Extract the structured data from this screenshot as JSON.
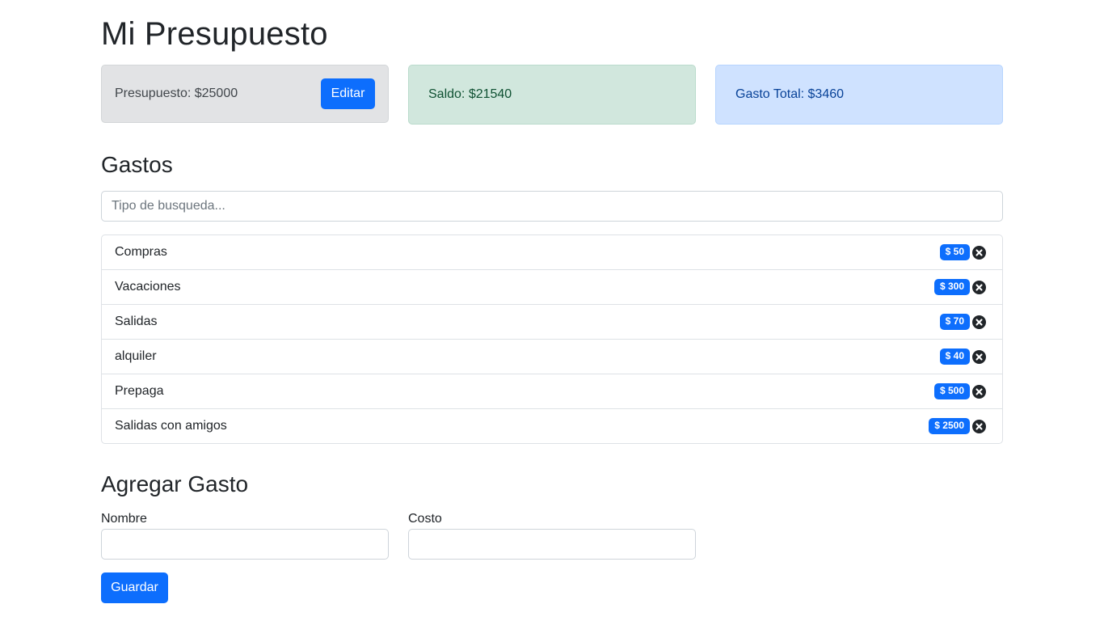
{
  "header": {
    "title": "Mi Presupuesto"
  },
  "summary": {
    "budget_text": "Presupuesto: $25000",
    "edit_label": "Editar",
    "balance_text": "Saldo: $21540",
    "total_text": "Gasto Total: $3460"
  },
  "expenses": {
    "title": "Gastos",
    "search_placeholder": "Tipo de busqueda...",
    "items": [
      {
        "name": "Compras",
        "cost": "$ 50"
      },
      {
        "name": "Vacaciones",
        "cost": "$ 300"
      },
      {
        "name": "Salidas",
        "cost": "$ 70"
      },
      {
        "name": "alquiler",
        "cost": "$ 40"
      },
      {
        "name": "Prepaga",
        "cost": "$ 500"
      },
      {
        "name": "Salidas con amigos",
        "cost": "$ 2500"
      }
    ]
  },
  "add_form": {
    "title": "Agregar Gasto",
    "name_label": "Nombre",
    "name_value": "",
    "cost_label": "Costo",
    "cost_value": "",
    "save_label": "Guardar"
  },
  "colors": {
    "primary": "#0d6efd",
    "budget_bg": "#e2e3e5",
    "balance_bg": "#d1e7dd",
    "total_bg": "#cfe2ff"
  },
  "icons": {
    "delete": "close-circle-icon"
  }
}
